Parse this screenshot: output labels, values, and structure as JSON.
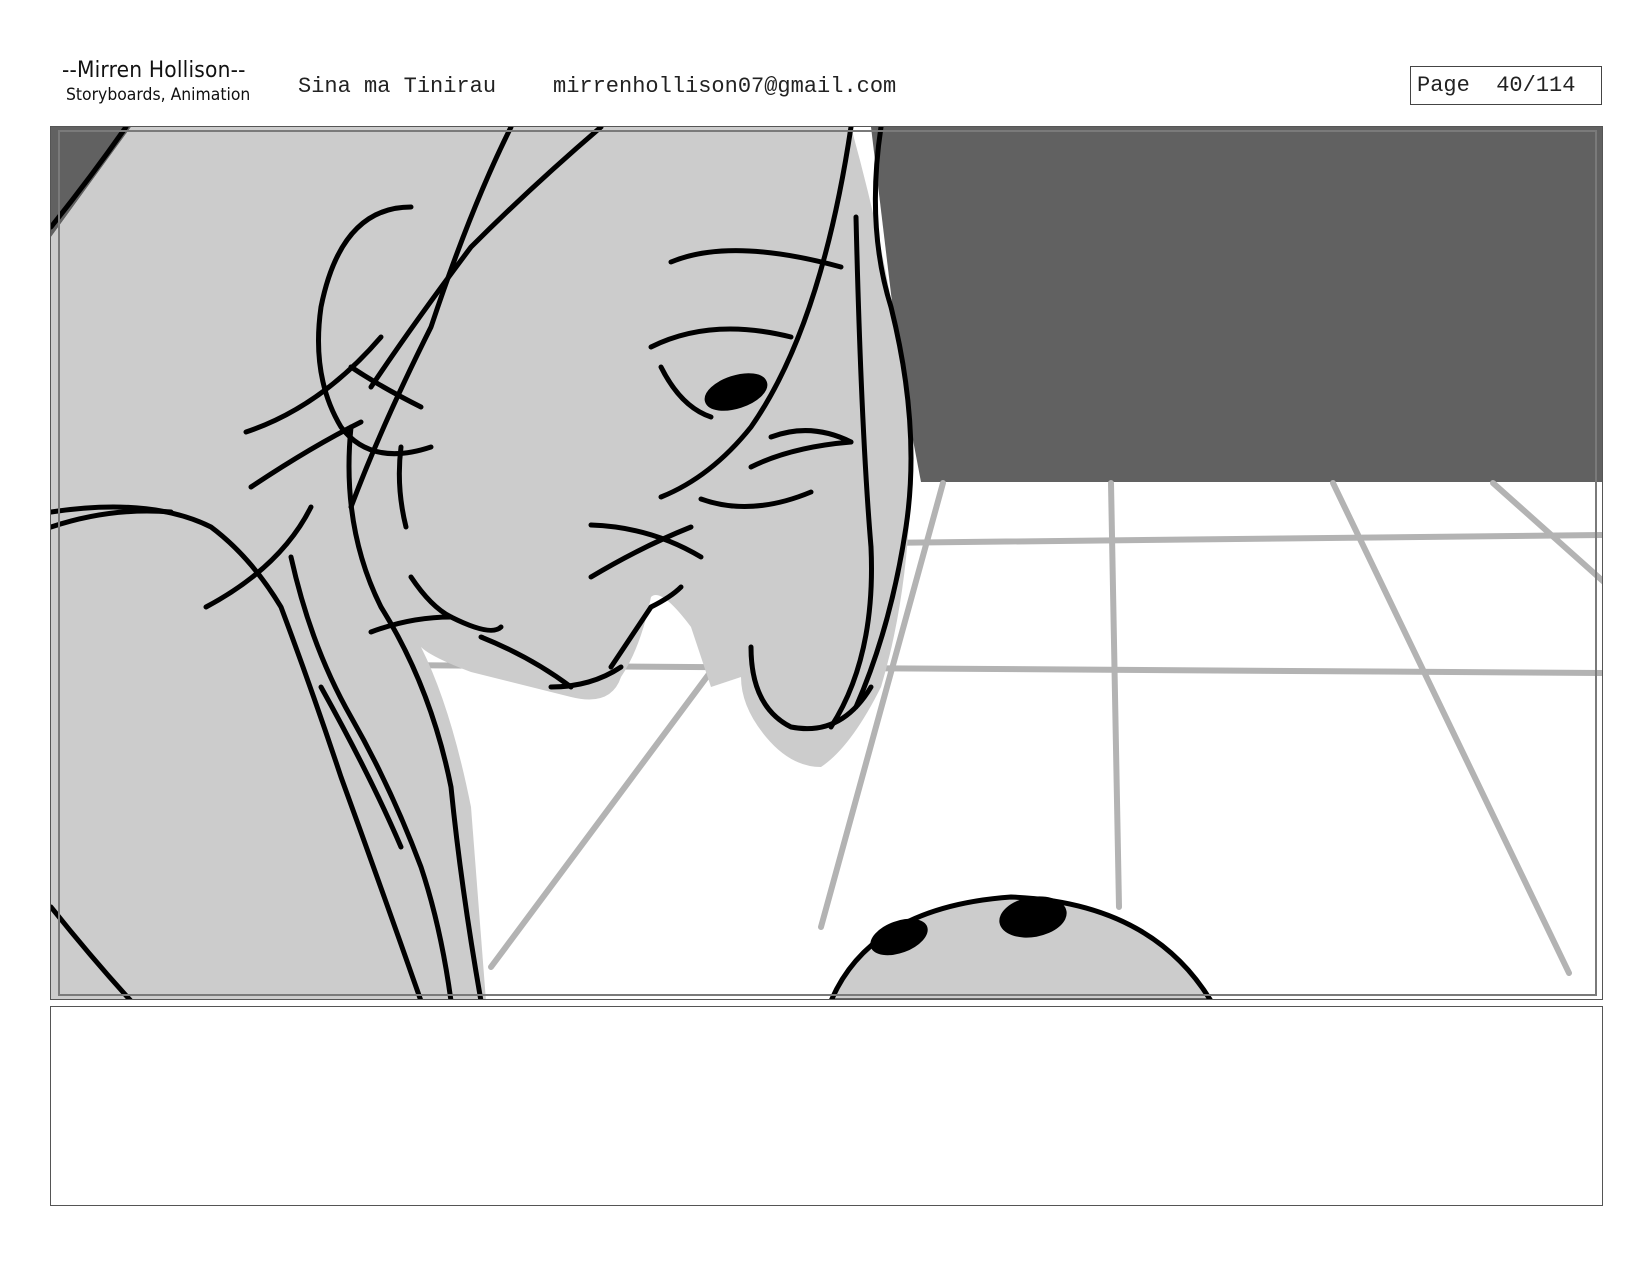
{
  "header": {
    "artist_name": "--Mirren Hollison--",
    "artist_role": "Storyboards, Animation",
    "project_title": "Sina ma Tinirau",
    "email": "mirrenhollison07@gmail.com",
    "page_label": "Page",
    "page_number": "40/114"
  },
  "panel": {
    "wall_color": "#616161",
    "skin_color": "#cccccc",
    "floor_color": "#ffffff",
    "grid_color": "#b3b3b3"
  },
  "notes": {
    "text": ""
  }
}
